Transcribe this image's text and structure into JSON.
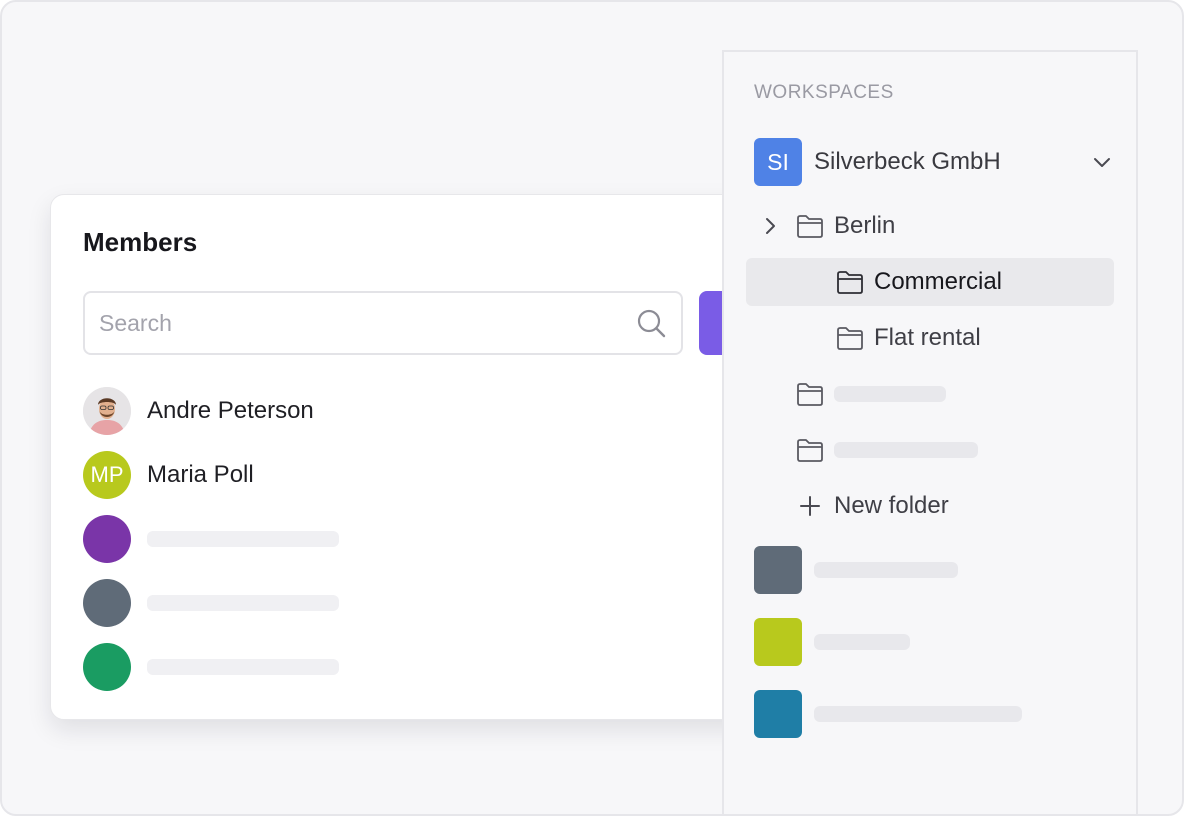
{
  "members": {
    "title": "Members",
    "search_placeholder": "Search",
    "list": [
      {
        "name": "Andre Peterson",
        "avatar": "photo"
      },
      {
        "name": "Maria Poll",
        "initials": "MP",
        "color": "#b8c91d"
      },
      {
        "color": "#7a35a8"
      },
      {
        "color": "#5f6b78"
      },
      {
        "color": "#1a9c62"
      }
    ],
    "accent_color": "#7a5ce6"
  },
  "workspaces": {
    "label": "WORKSPACES",
    "org": {
      "initials": "SI",
      "name": "Silverbeck GmbH",
      "color": "#4f82e6"
    },
    "folders": [
      {
        "label": "Berlin",
        "level": 0,
        "expandable": true
      },
      {
        "label": "Commercial",
        "level": 1,
        "selected": true
      },
      {
        "label": "Flat rental",
        "level": 1
      }
    ],
    "new_folder_label": "New folder",
    "other_workspace_colors": [
      "#5f6b78",
      "#b8c91d",
      "#1f7ea6"
    ]
  }
}
